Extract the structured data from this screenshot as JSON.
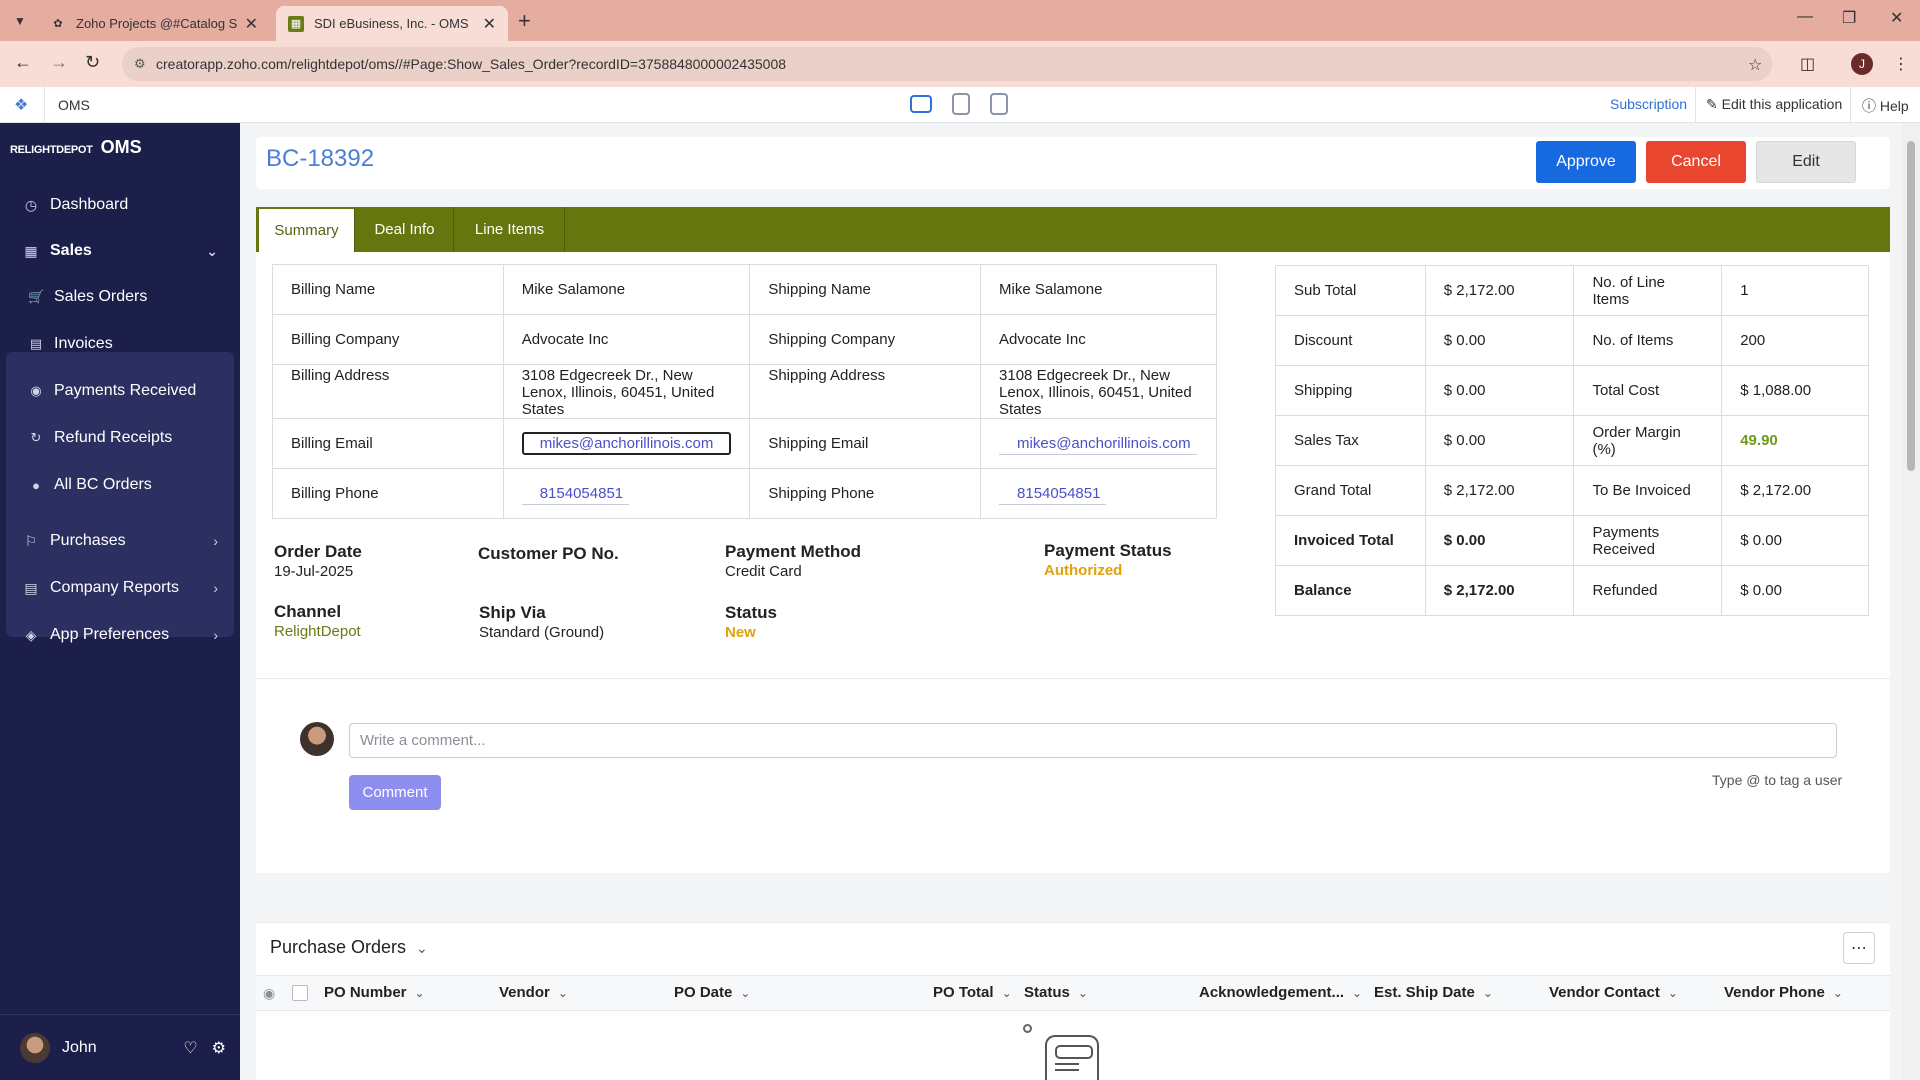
{
  "browser": {
    "tabs": [
      {
        "title": "Zoho Projects @#Catalog Says...",
        "favicon": "zoho-projects-icon"
      },
      {
        "title": "SDI eBusiness, Inc. -  OMS",
        "favicon": "oms-icon"
      }
    ],
    "url": "creatorapp.zoho.com/relightdepot/oms//#Page:Show_Sales_Order?recordID=3758848000002435008",
    "profile_initial": "J"
  },
  "topbar": {
    "app_name": "OMS",
    "subscription": "Subscription",
    "edit_app": "Edit this application",
    "help": "Help"
  },
  "sidebar": {
    "brand_small": "RELIGHTDEPOT",
    "brand_big": "OMS",
    "dashboard": "Dashboard",
    "sales": "Sales",
    "sales_items": [
      "Sales Orders",
      "Invoices",
      "Payments Received",
      "Refund Receipts",
      "All BC Orders"
    ],
    "purchases": "Purchases",
    "company_reports": "Company Reports",
    "app_preferences": "App Preferences",
    "user_name": "John"
  },
  "record": {
    "id": "BC-18392",
    "approve": "Approve",
    "cancel": "Cancel",
    "edit": "Edit",
    "tabs": [
      "Summary",
      "Deal Info",
      "Line Items"
    ]
  },
  "billing": {
    "billing_name_label": "Billing Name",
    "billing_name": "Mike Salamone",
    "shipping_name_label": "Shipping Name",
    "shipping_name": "Mike Salamone",
    "billing_company_label": "Billing Company",
    "billing_company": "Advocate Inc",
    "shipping_company_label": "Shipping Company",
    "shipping_company": "Advocate Inc",
    "billing_address_label": "Billing Address",
    "billing_address": "3108 Edgecreek Dr., New Lenox, Illinois, 60451, United States",
    "shipping_address_label": "Shipping Address",
    "shipping_address": "3108 Edgecreek Dr., New Lenox, Illinois, 60451, United States",
    "billing_email_label": "Billing Email",
    "billing_email": "mikes@anchorillinois.com",
    "shipping_email_label": "Shipping Email",
    "shipping_email": "mikes@anchorillinois.com",
    "billing_phone_label": "Billing Phone",
    "billing_phone": "8154054851",
    "shipping_phone_label": "Shipping Phone",
    "shipping_phone": "8154054851"
  },
  "totals": {
    "sub_total_label": "Sub Total",
    "sub_total": "$ 2,172.00",
    "line_items_label": "No. of Line Items",
    "line_items": "1",
    "discount_label": "Discount",
    "discount": "$ 0.00",
    "items_label": "No. of Items",
    "items": "200",
    "shipping_label": "Shipping",
    "shipping": "$ 0.00",
    "total_cost_label": "Total Cost",
    "total_cost": "$ 1,088.00",
    "sales_tax_label": "Sales Tax",
    "sales_tax": "$ 0.00",
    "order_margin_label": "Order Margin (%)",
    "order_margin": "49.90",
    "grand_total_label": "Grand Total",
    "grand_total": "$ 2,172.00",
    "to_be_invoiced_label": "To Be Invoiced",
    "to_be_invoiced": "$ 2,172.00",
    "invoiced_total_label": "Invoiced Total",
    "invoiced_total": "$ 0.00",
    "payments_received_label": "Payments Received",
    "payments_received": "$ 0.00",
    "balance_label": "Balance",
    "balance": "$ 2,172.00",
    "refunded_label": "Refunded",
    "refunded": "$ 0.00"
  },
  "order": {
    "order_date_label": "Order Date",
    "order_date": "19-Jul-2025",
    "customer_po_label": "Customer PO No.",
    "payment_method_label": "Payment Method",
    "payment_method": "Credit Card",
    "payment_status_label": "Payment Status",
    "payment_status": "Authorized",
    "channel_label": "Channel",
    "channel": "RelightDepot",
    "ship_via_label": "Ship Via",
    "ship_via": "Standard (Ground)",
    "status_label": "Status",
    "status": "New"
  },
  "comment": {
    "placeholder": "Write a comment...",
    "button": "Comment",
    "hint": "Type @ to tag a user"
  },
  "purchase_orders": {
    "title": "Purchase Orders",
    "columns": [
      "PO Number",
      "Vendor",
      "PO Date",
      "PO Total",
      "Status",
      "Acknowledgement...",
      "Est. Ship Date",
      "Vendor Contact",
      "Vendor Phone"
    ]
  },
  "colors": {
    "accent_green": "#65760f",
    "approve_blue": "#1769e0",
    "cancel_red": "#e8462e",
    "sidebar_bg": "#1c1f4a"
  }
}
